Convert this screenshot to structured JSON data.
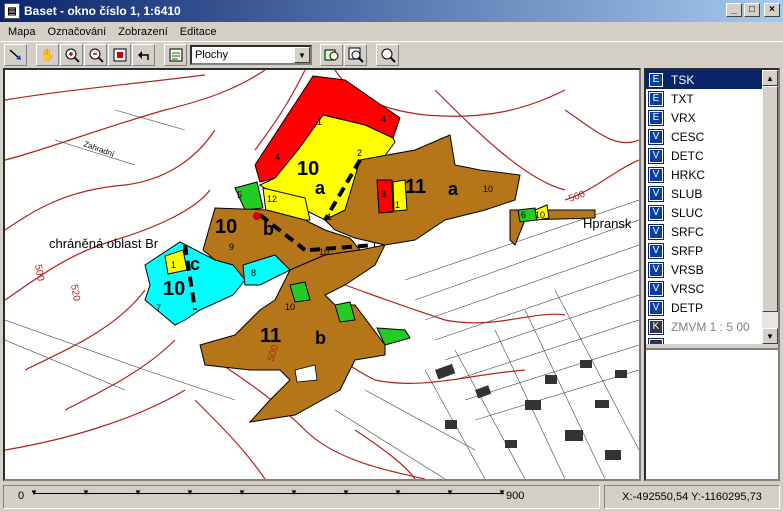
{
  "window": {
    "title": "Baset - okno číslo 1, 1:6410",
    "min_label": "_",
    "max_label": "□",
    "close_label": "×"
  },
  "menu": [
    "Mapa",
    "Označování",
    "Zobrazení",
    "Editace"
  ],
  "toolbar": {
    "layer_select": "Plochy"
  },
  "map": {
    "labels": {
      "stand_10a": "10",
      "stand_10a_sub": "a",
      "stand_11a": "11",
      "stand_11a_sub": "a",
      "stand_10b": "10",
      "stand_10b_sub": "b",
      "stand_10c": "10",
      "stand_10c_sub": "c",
      "stand_11b": "11",
      "stand_11b_sub": "b",
      "n1": "1",
      "n2": "2",
      "n3": "3",
      "n4": "4",
      "n4b": "4",
      "n5": "5",
      "n6": "6",
      "n7": "7",
      "n8": "8",
      "n9": "9",
      "n10a": "10",
      "n10b": "10",
      "n10c": "10",
      "n10d": "10",
      "n12": "12",
      "n1b": "1",
      "n1c": "1",
      "n1d": "1",
      "protected_area": "chráněná oblast Br",
      "place_name": "Hpransk",
      "street": "Zahradní",
      "contour_500": "500",
      "contour_520": "520",
      "contour_500b": "500",
      "contour_560": "560"
    }
  },
  "layers": [
    {
      "badge": "E",
      "name": "TSK",
      "selected": true
    },
    {
      "badge": "E",
      "name": "TXT"
    },
    {
      "badge": "E",
      "name": "VRX"
    },
    {
      "badge": "V",
      "name": "CESC"
    },
    {
      "badge": "V",
      "name": "DETC"
    },
    {
      "badge": "V",
      "name": "HRKC"
    },
    {
      "badge": "V",
      "name": "SLUB"
    },
    {
      "badge": "V",
      "name": "SLUC"
    },
    {
      "badge": "V",
      "name": "SRFC"
    },
    {
      "badge": "V",
      "name": "SRFP"
    },
    {
      "badge": "V",
      "name": "VRSB"
    },
    {
      "badge": "V",
      "name": "VRSC"
    },
    {
      "badge": "V",
      "name": "DETP"
    },
    {
      "badge": "K",
      "name": "ZMVM 1 : 5 00",
      "dim": true
    },
    {
      "badge": "",
      "name": "",
      "dim": true
    }
  ],
  "status": {
    "scale_start": "0",
    "scale_end": "900",
    "coords": "X:-492550,54 Y:-1160295,73"
  },
  "colors": {
    "contour": "#b22222",
    "brown": "#b5761a",
    "yellow": "#ffff00",
    "red": "#ff0000",
    "green": "#22cc22",
    "cyan": "#00ffff",
    "selection": "#0a246a"
  }
}
